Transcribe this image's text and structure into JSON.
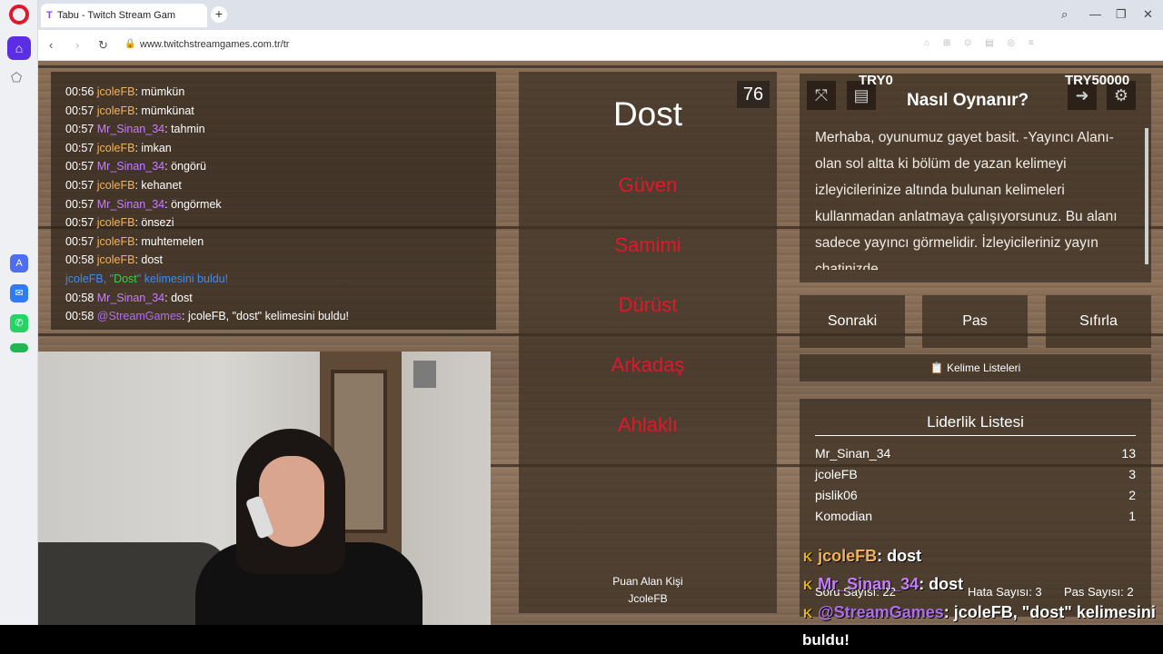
{
  "browser": {
    "tab_title": "Tabu - Twitch Stream Gam",
    "url": "www.twitchstreamgames.com.tr/tr",
    "new_tab": "+",
    "back": "‹",
    "forward": "›",
    "reload": "↻",
    "search": "⌕",
    "minimize": "—",
    "maximize": "❐",
    "close": "✕"
  },
  "chat": {
    "messages": [
      {
        "time": "00:56",
        "user": "jcoleFB",
        "text": ": mümkün",
        "color": "#f0b35b"
      },
      {
        "time": "00:57",
        "user": "jcoleFB",
        "text": ": mümkünat",
        "color": "#f0b35b"
      },
      {
        "time": "00:57",
        "user": "Mr_Sinan_34",
        "text": ": tahmin",
        "color": "#c77dff"
      },
      {
        "time": "00:57",
        "user": "jcoleFB",
        "text": ": imkan",
        "color": "#f0b35b"
      },
      {
        "time": "00:57",
        "user": "Mr_Sinan_34",
        "text": ": öngörü",
        "color": "#c77dff"
      },
      {
        "time": "00:57",
        "user": "jcoleFB",
        "text": ": kehanet",
        "color": "#f0b35b"
      },
      {
        "time": "00:57",
        "user": "Mr_Sinan_34",
        "text": ": öngörmek",
        "color": "#c77dff"
      },
      {
        "time": "00:57",
        "user": "jcoleFB",
        "text": ": önsezi",
        "color": "#f0b35b"
      },
      {
        "time": "00:57",
        "user": "jcoleFB",
        "text": ": muhtemelen",
        "color": "#f0b35b"
      },
      {
        "time": "00:58",
        "user": "jcoleFB",
        "text": ": dost",
        "color": "#f0b35b"
      }
    ],
    "system_line": {
      "user": "jcoleFB",
      "pre": ", \"",
      "word": "Dost",
      "post": "\" kelimesini buldu!"
    },
    "after": [
      {
        "time": "00:58",
        "user": "Mr_Sinan_34",
        "text": ": dost",
        "color": "#c77dff"
      },
      {
        "time": "00:58",
        "user": "@StreamGames",
        "text": ": jcoleFB, \"dost\" kelimesini buldu!",
        "color": "#b06cf0"
      }
    ]
  },
  "card": {
    "timer": "76",
    "word": "Dost",
    "taboo": [
      "Güven",
      "Samimi",
      "Dürüst",
      "Arkadaş",
      "Ahlaklı"
    ],
    "scorer_label": "Puan Alan Kişi",
    "scorer": "JcoleFB"
  },
  "donation": {
    "min": "TRY0",
    "max": "TRY50000"
  },
  "help": {
    "title": "Nasıl Oynanır?",
    "text": "Merhaba, oyunumuz gayet basit. -Yayıncı Alanı- olan sol altta ki bölüm de yazan kelimeyi izleyicilerinize altında bulunan kelimeleri kullanmadan anlatmaya çalışıyorsunuz. Bu alanı sadece yayıncı görmelidir. İzleyicileriniz yayın chatinizde"
  },
  "buttons": {
    "next": "Sonraki",
    "pass": "Pas",
    "reset": "Sıfırla",
    "word_lists": "📋 Kelime Listeleri"
  },
  "leaderboard": {
    "title": "Liderlik Listesi",
    "rows": [
      {
        "name": "Mr_Sinan_34",
        "score": "13"
      },
      {
        "name": "jcoleFB",
        "score": "3"
      },
      {
        "name": "pislik06",
        "score": "2"
      },
      {
        "name": "Komodian",
        "score": "1"
      }
    ],
    "stats": {
      "questions": "Soru Sayısı: 22",
      "errors": "Hata Sayısı: 3",
      "passes": "Pas Sayısı: 2"
    }
  },
  "overlay": {
    "line1_user": "jcoleFB",
    "line1_text": ": dost",
    "line2_user": "Mr_Sinan_34",
    "line2_text": ": dost",
    "line3_user": "@StreamGames",
    "line3_text": ": jcoleFB, \"dost\" kelimesini",
    "line4_text": "buldu!"
  }
}
